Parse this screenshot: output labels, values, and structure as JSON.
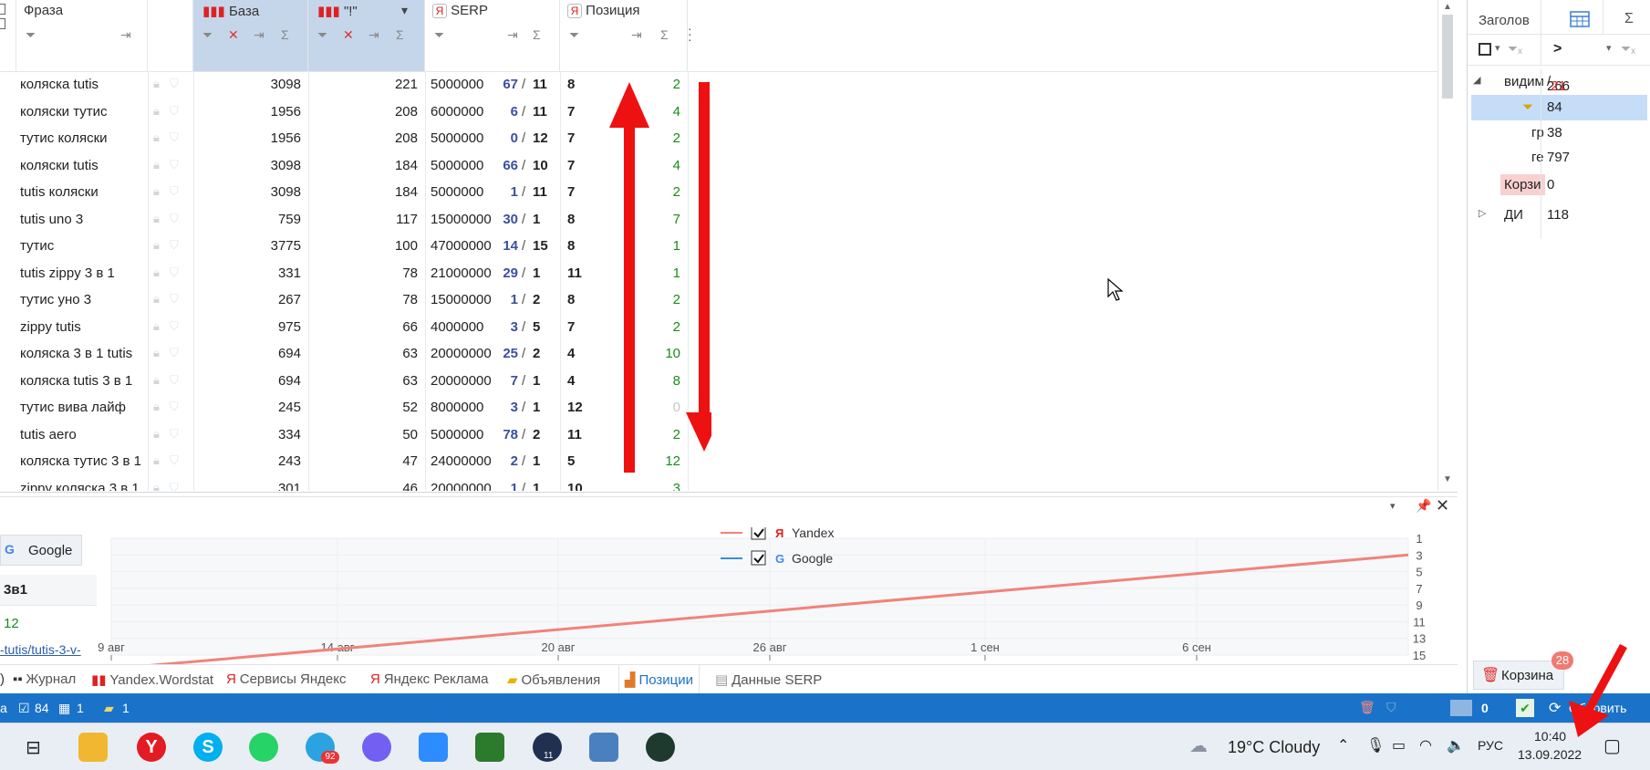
{
  "grid": {
    "columns": {
      "phrase": "Фраза",
      "base": "База",
      "excl": "\"!\"",
      "serp": "SERP",
      "position": "Позиция"
    },
    "rows": [
      {
        "phrase": "коляска tutis",
        "base": "3098",
        "excl": "221",
        "serp": "5000000",
        "pa": "67",
        "pb": "11",
        "pos": "8",
        "delta": "2"
      },
      {
        "phrase": "коляски тутис",
        "base": "1956",
        "excl": "208",
        "serp": "6000000",
        "pa": "6",
        "pb": "11",
        "pos": "7",
        "delta": "4"
      },
      {
        "phrase": "тутис коляски",
        "base": "1956",
        "excl": "208",
        "serp": "5000000",
        "pa": "0",
        "pb": "12",
        "pos": "7",
        "delta": "2"
      },
      {
        "phrase": "коляски tutis",
        "base": "3098",
        "excl": "184",
        "serp": "5000000",
        "pa": "66",
        "pb": "10",
        "pos": "7",
        "delta": "4"
      },
      {
        "phrase": "tutis коляски",
        "base": "3098",
        "excl": "184",
        "serp": "5000000",
        "pa": "1",
        "pb": "11",
        "pos": "7",
        "delta": "2"
      },
      {
        "phrase": "tutis uno 3",
        "base": "759",
        "excl": "117",
        "serp": "15000000",
        "pa": "30",
        "pb": "1",
        "pos": "8",
        "delta": "7"
      },
      {
        "phrase": "тутис",
        "base": "3775",
        "excl": "100",
        "serp": "47000000",
        "pa": "14",
        "pb": "15",
        "pos": "8",
        "delta": "1"
      },
      {
        "phrase": "tutis zippy 3 в 1",
        "base": "331",
        "excl": "78",
        "serp": "21000000",
        "pa": "29",
        "pb": "1",
        "pos": "11",
        "delta": "1"
      },
      {
        "phrase": "тутис уно 3",
        "base": "267",
        "excl": "78",
        "serp": "15000000",
        "pa": "1",
        "pb": "2",
        "pos": "8",
        "delta": "2"
      },
      {
        "phrase": "zippy tutis",
        "base": "975",
        "excl": "66",
        "serp": "4000000",
        "pa": "3",
        "pb": "5",
        "pos": "7",
        "delta": "2"
      },
      {
        "phrase": "коляска 3 в 1 tutis",
        "base": "694",
        "excl": "63",
        "serp": "20000000",
        "pa": "25",
        "pb": "2",
        "pos": "4",
        "delta": "10"
      },
      {
        "phrase": "коляска tutis 3 в 1",
        "base": "694",
        "excl": "63",
        "serp": "20000000",
        "pa": "7",
        "pb": "1",
        "pos": "4",
        "delta": "8"
      },
      {
        "phrase": "тутис вива лайф",
        "base": "245",
        "excl": "52",
        "serp": "8000000",
        "pa": "3",
        "pb": "1",
        "pos": "12",
        "delta": "0"
      },
      {
        "phrase": "tutis aero",
        "base": "334",
        "excl": "50",
        "serp": "5000000",
        "pa": "78",
        "pb": "2",
        "pos": "11",
        "delta": "2"
      },
      {
        "phrase": "коляска тутис 3 в 1",
        "base": "243",
        "excl": "47",
        "serp": "24000000",
        "pa": "2",
        "pb": "1",
        "pos": "5",
        "delta": "12"
      },
      {
        "phrase": "zippy коляска 3 в 1",
        "base": "301",
        "excl": "46",
        "serp": "20000000",
        "pa": "1",
        "pb": "1",
        "pos": "10",
        "delta": "3"
      }
    ]
  },
  "right_panel": {
    "header_label": "Заголов",
    "filter_op": ">",
    "tree": [
      {
        "label": "видим",
        "value": "266",
        "value2": "21"
      },
      {
        "label": "",
        "value": "84"
      },
      {
        "label": "гр",
        "value": "38"
      },
      {
        "label": "ге",
        "value": "797"
      },
      {
        "label": "Корзи",
        "value": "0"
      },
      {
        "label": "ДИ",
        "value": "118"
      }
    ],
    "trash_label": "Корзина",
    "trash_badge": "28"
  },
  "chart_panel": {
    "google_button": "Google",
    "left_table_header": "3в1",
    "left_table_value": "12",
    "left_link": "-tutis/tutis-3-v-"
  },
  "chart_data": {
    "type": "line",
    "series": [
      {
        "name": "Yandex",
        "color": "#f0837a",
        "x": [
          "8 авг",
          "9 сен"
        ],
        "y": [
          16,
          3
        ]
      },
      {
        "name": "Google",
        "color": "#3a8fd8",
        "x": [],
        "y": []
      }
    ],
    "x_ticks": [
      "9 авг",
      "14 авг",
      "20 авг",
      "26 авг",
      "1 сен",
      "6 сен"
    ],
    "y_ticks": [
      "1",
      "3",
      "5",
      "7",
      "9",
      "11",
      "13",
      "15"
    ],
    "ylim": [
      1,
      15
    ],
    "y_inverted": true,
    "grid": true,
    "legend_position": "top"
  },
  "tabs": [
    {
      "label": "Журнал"
    },
    {
      "label": "Yandex.Wordstat"
    },
    {
      "label": "Сервисы Яндекс"
    },
    {
      "label": "Яндекс Реклама"
    },
    {
      "label": "Объявления"
    },
    {
      "label": "Позиции",
      "active": true
    },
    {
      "label": "Данные SERP"
    }
  ],
  "status": {
    "checked_count": "84",
    "table_count": "1",
    "note_count": "1",
    "img_count": "0",
    "refresh_label": "Обновить"
  },
  "taskbar": {
    "weather": "19°C  Cloudy",
    "lang": "РУС",
    "time": "10:40",
    "date": "13.09.2022",
    "telegram_badge": "92",
    "clock_badge": "11"
  }
}
